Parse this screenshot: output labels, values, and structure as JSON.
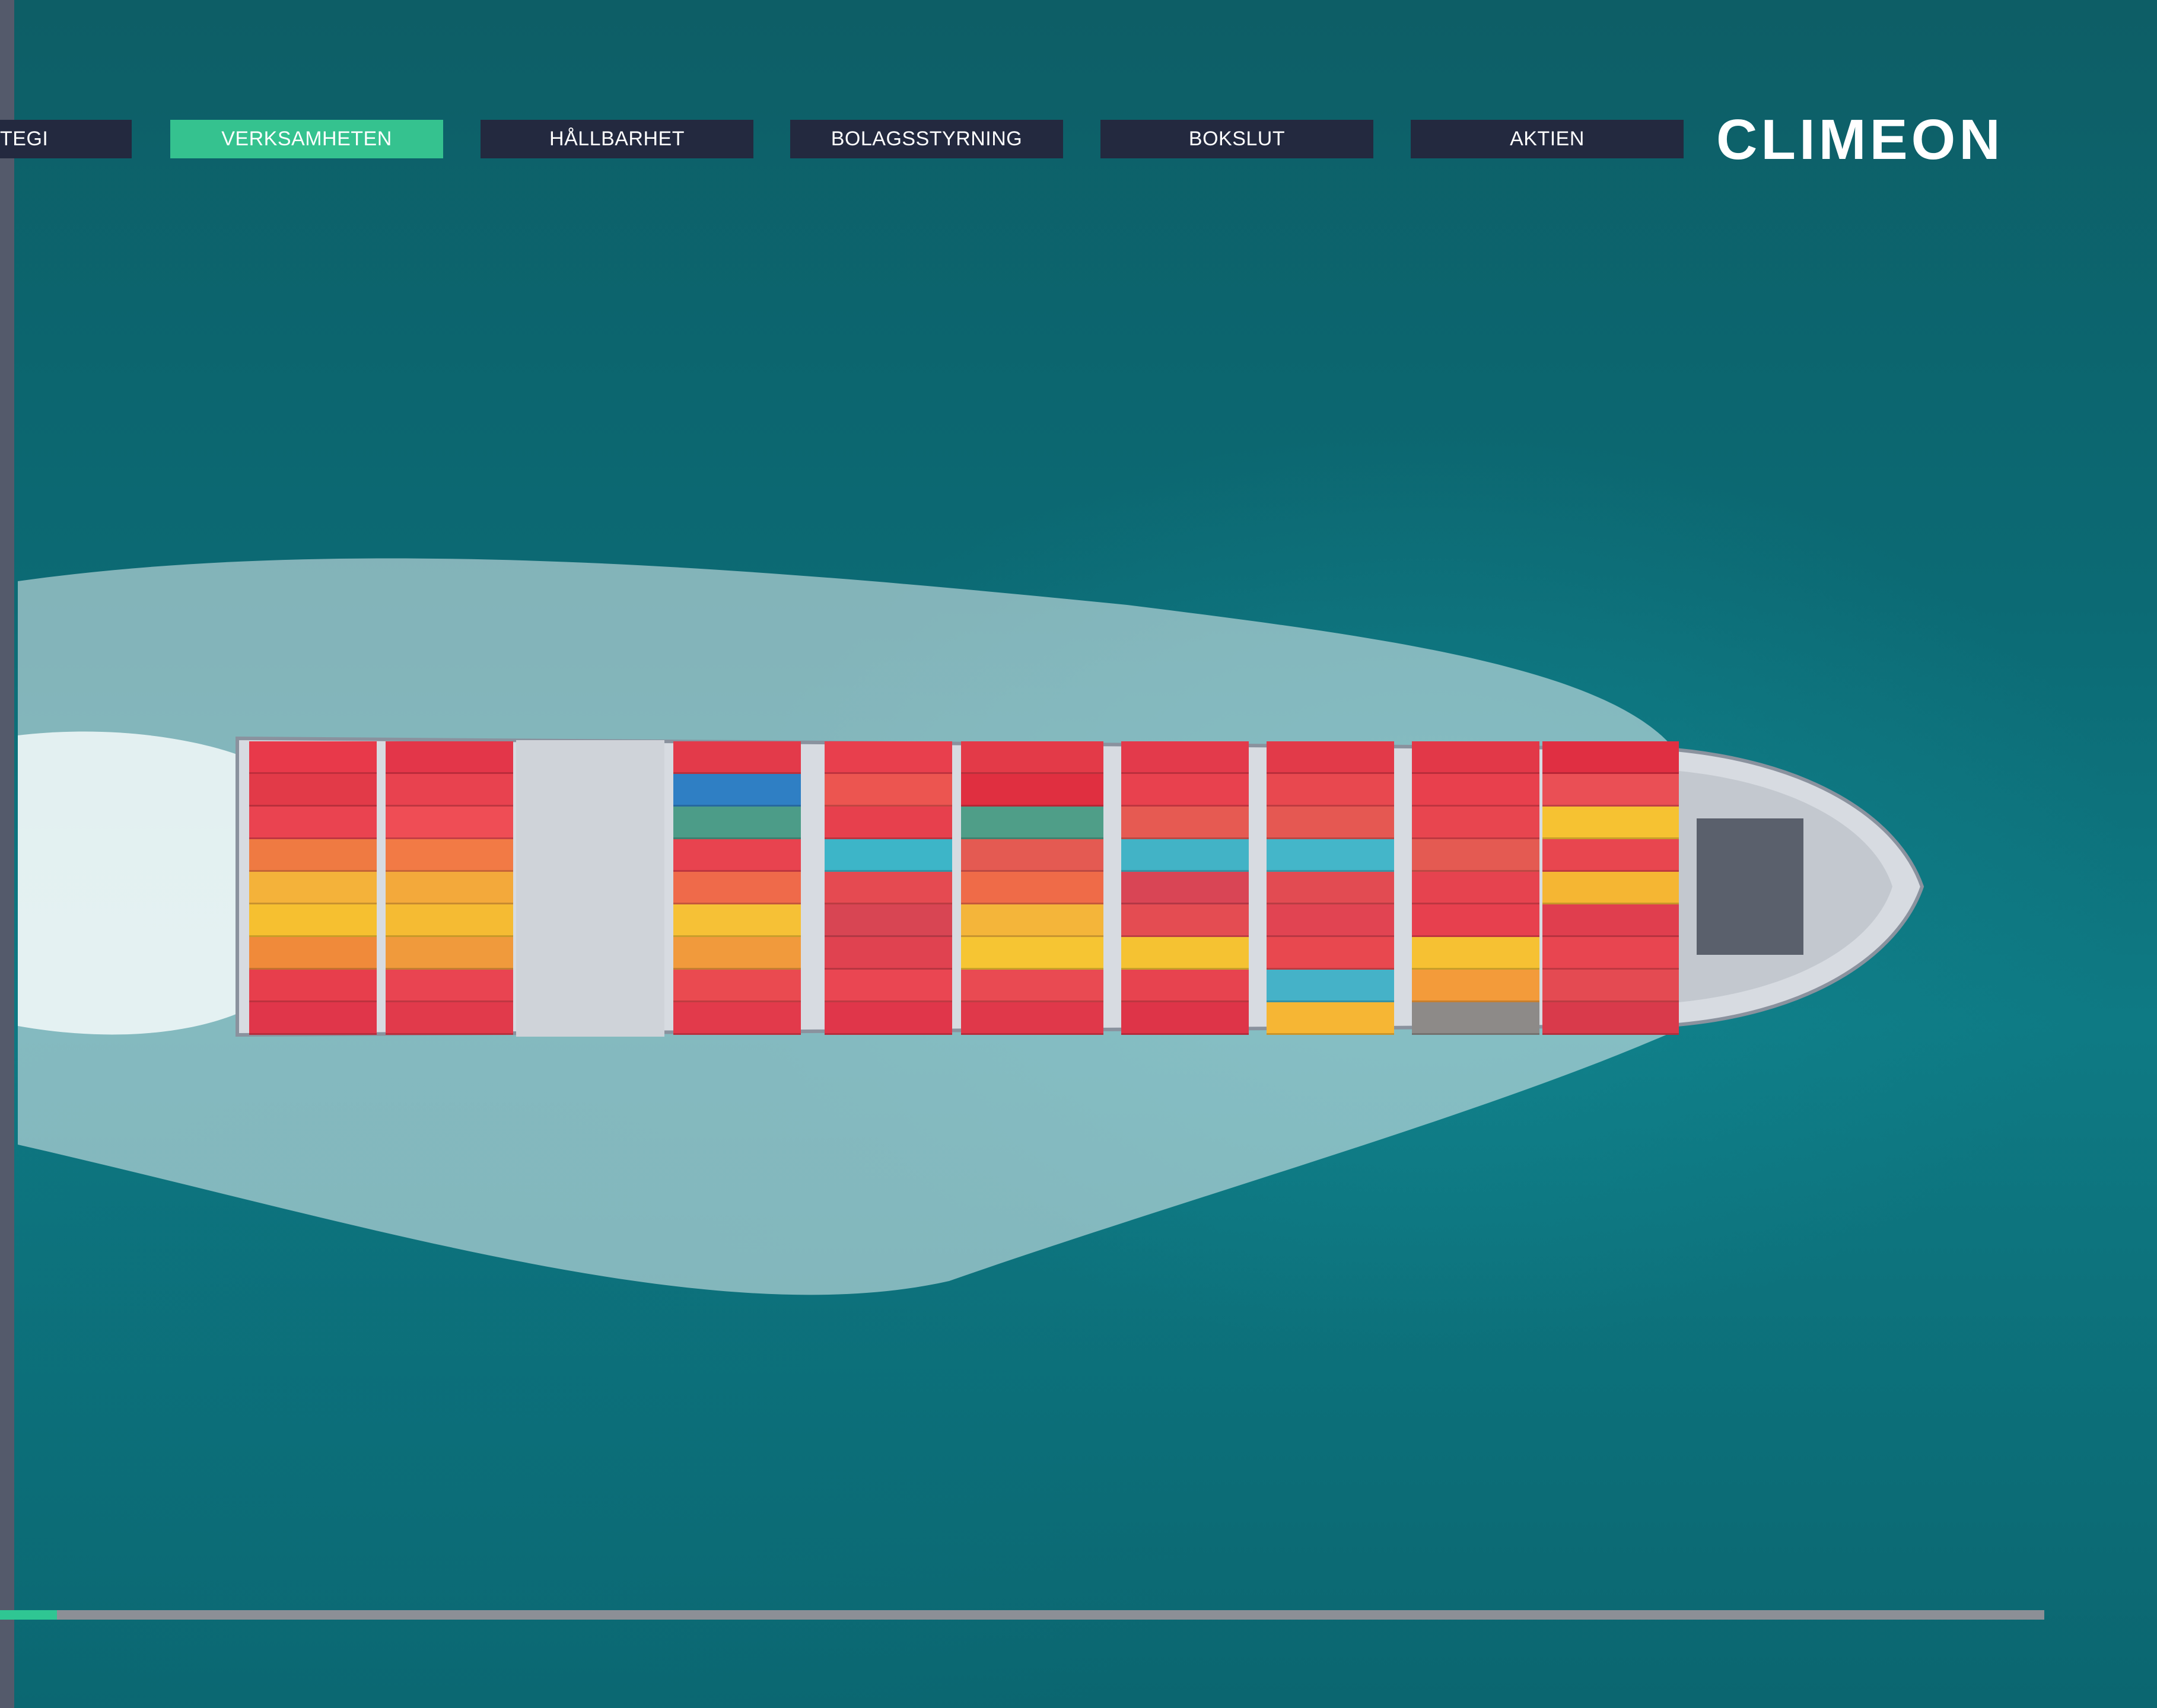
{
  "nav": {
    "items": [
      {
        "label": "TEGI",
        "active": false
      },
      {
        "label": "VERKSAMHETEN",
        "active": true
      },
      {
        "label": "HÅLLBARHET",
        "active": false
      },
      {
        "label": "BOLAGSSTYRNING",
        "active": false
      },
      {
        "label": "BOKSLUT",
        "active": false
      },
      {
        "label": "AKTIEN",
        "active": false
      }
    ]
  },
  "brand": {
    "logo_text": "CLIMEON"
  },
  "progress": {
    "value_percent": 2.8
  },
  "colors": {
    "nav_background": "#23293f",
    "nav_active": "#35c28f",
    "progress_track": "#8c8f96",
    "progress_fill": "#2fc693",
    "sea": "#0c6a74"
  }
}
